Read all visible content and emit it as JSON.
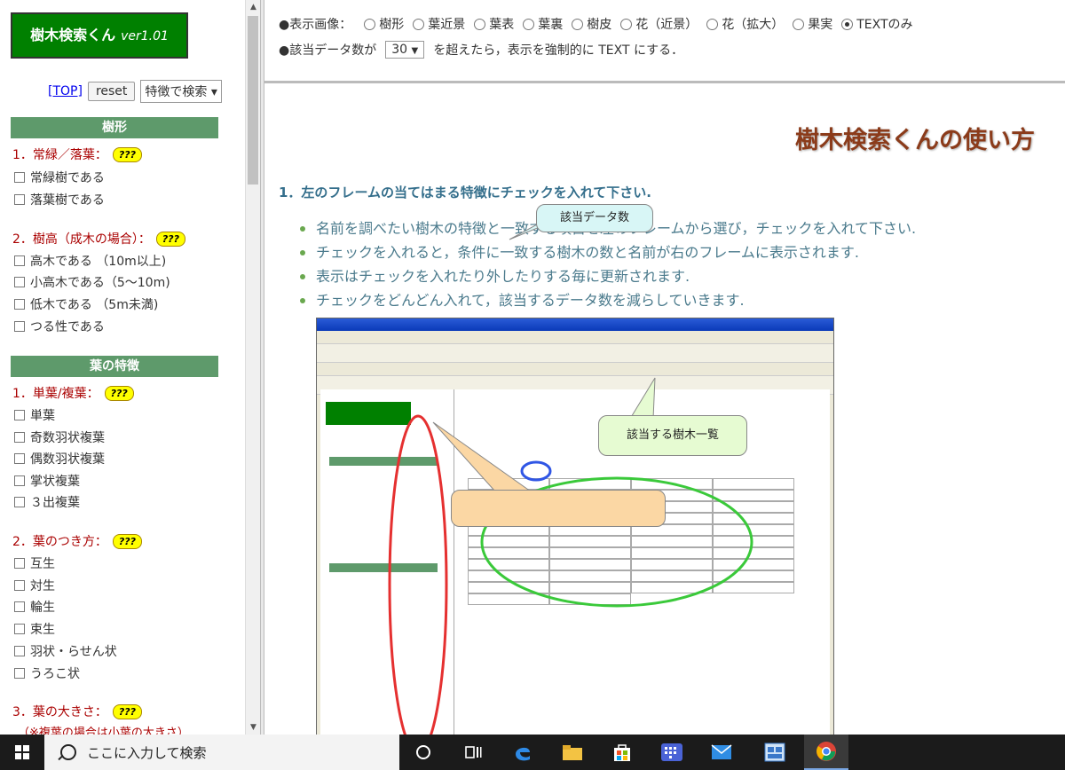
{
  "left": {
    "logo_title": "樹木検索くん",
    "logo_version": "ver1.01",
    "top_link": "[TOP]",
    "reset_label": "reset",
    "mode_select": "特徴で検索 ▾",
    "section1": "樹形",
    "q1": "1．常緑／落葉：",
    "q1_opts": [
      "常緑樹である",
      "落葉樹である"
    ],
    "q2": "2．樹高（成木の場合）：",
    "q2_opts": [
      "高木である （10m以上)",
      "小高木である（5～10m)",
      "低木である （5m未満)",
      "つる性である"
    ],
    "section2": "葉の特徴",
    "q3": "1．単葉/複葉：",
    "q3_opts": [
      "単葉",
      "奇数羽状複葉",
      "偶数羽状複葉",
      "掌状複葉",
      "３出複葉"
    ],
    "q4": "2．葉のつき方：",
    "q4_opts": [
      "互生",
      "対生",
      "輪生",
      "束生",
      "羽状・らせん状",
      "うろこ状"
    ],
    "q5": "3．葉の大きさ：",
    "q5_note": "（※複葉の場合は小葉の大きさ）",
    "badge": "???"
  },
  "top": {
    "display_label": "●表示画像：",
    "radios": [
      "樹形",
      "葉近景",
      "葉表",
      "葉裏",
      "樹皮",
      "花（近景）",
      "花（拡大）",
      "果実",
      "TEXTのみ"
    ],
    "selected": "TEXTのみ",
    "count_prefix": "●該当データ数が",
    "count_value": "30",
    "count_suffix": "を超えたら，表示を強制的に TEXT にする．"
  },
  "main": {
    "title": "樹木検索くんの使い方",
    "step1": "1．左のフレームの当てはまる特徴にチェックを入れて下さい.",
    "bullets": [
      "名前を調べたい樹木の特徴と一致する項目を左のフレームから選び，チェックを入れて下さい.",
      "チェックを入れると，条件に一致する樹木の数と名前が右のフレームに表示されます.",
      "表示はチェックを入れたり外したりする毎に更新されます.",
      "チェックをどんどん入れて，該当するデータ数を減らしていきます."
    ],
    "callout_count": "該当データ数",
    "callout_list": "該当する樹木一覧"
  },
  "taskbar": {
    "search_placeholder": "ここに入力して検索"
  }
}
